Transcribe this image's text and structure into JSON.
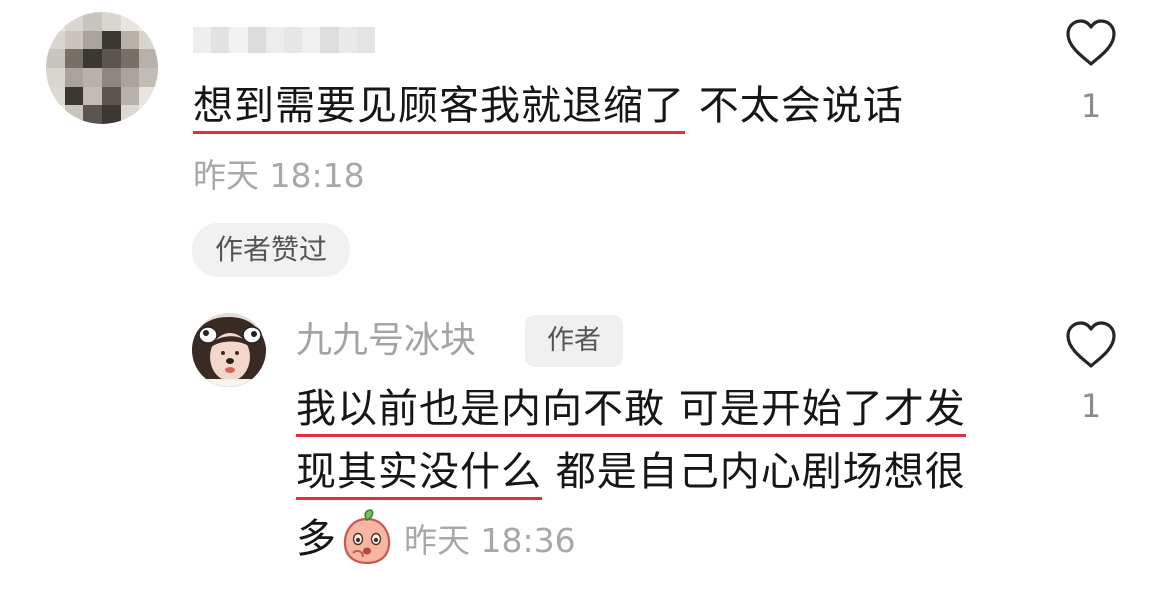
{
  "comment": {
    "text_underlined": "想到需要见顾客我就退缩了",
    "text_rest": " 不太会说话",
    "time": "昨天 18:18",
    "author_liked": "作者赞过",
    "like_count": "1"
  },
  "reply": {
    "username": "九九号冰块",
    "author_tag": "作者",
    "line1_underlined": "我以前也是内向不敢 可是开始了才发",
    "line2_underlined": "现其实没什么",
    "line2_rest": " 都是自己内心剧场想很",
    "line3": "多",
    "time": "昨天 18:36",
    "like_count": "1"
  },
  "colors": {
    "underline": "#e02e3b",
    "muted": "#a8a8a8",
    "text": "#161616"
  },
  "icons": [
    "heart-outline-icon",
    "heart-outline-icon",
    "peach-emoji-icon"
  ]
}
